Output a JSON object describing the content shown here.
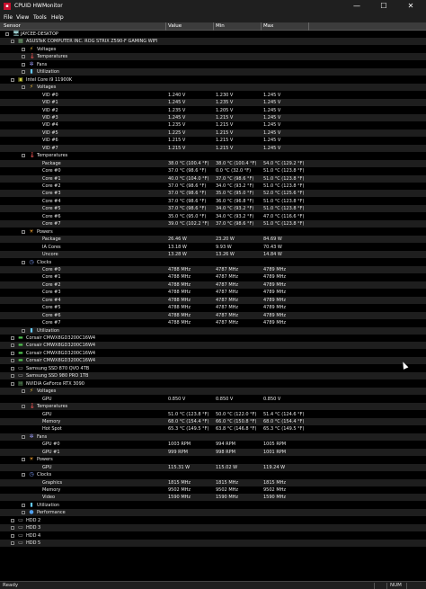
{
  "window": {
    "title": "CPUID HWMonitor",
    "controls": {
      "minimize": "—",
      "maximize": "☐",
      "close": "✕"
    }
  },
  "menu": [
    "File",
    "View",
    "Tools",
    "Help"
  ],
  "columns": {
    "sensor": "Sensor",
    "value": "Value",
    "min": "Min",
    "max": "Max"
  },
  "rows": [
    {
      "level": 0,
      "icon": "computer-icon",
      "label": "JAYCEE-DESKTOP"
    },
    {
      "level": 1,
      "icon": "motherboard-icon",
      "label": "ASUSTeK COMPUTER INC. ROG STRIX Z590-F GAMING WIFI"
    },
    {
      "level": 2,
      "icon": "voltage-icon",
      "label": "Voltages"
    },
    {
      "level": 2,
      "icon": "temperature-icon",
      "label": "Temperatures"
    },
    {
      "level": 2,
      "icon": "fan-icon",
      "label": "Fans"
    },
    {
      "level": 2,
      "icon": "utilization-icon",
      "label": "Utilization"
    },
    {
      "level": 1,
      "icon": "cpu-icon",
      "label": "Intel Core i9 11900K"
    },
    {
      "level": 2,
      "icon": "voltage-icon",
      "label": "Voltages"
    },
    {
      "level": 3,
      "label": "VID #0",
      "value": "1.240 V",
      "min": "1.230 V",
      "max": "1.245 V"
    },
    {
      "level": 3,
      "label": "VID #1",
      "value": "1.245 V",
      "min": "1.235 V",
      "max": "1.245 V"
    },
    {
      "level": 3,
      "label": "VID #2",
      "value": "1.235 V",
      "min": "1.205 V",
      "max": "1.245 V"
    },
    {
      "level": 3,
      "label": "VID #3",
      "value": "1.245 V",
      "min": "1.215 V",
      "max": "1.245 V"
    },
    {
      "level": 3,
      "label": "VID #4",
      "value": "1.235 V",
      "min": "1.215 V",
      "max": "1.245 V"
    },
    {
      "level": 3,
      "label": "VID #5",
      "value": "1.225 V",
      "min": "1.215 V",
      "max": "1.245 V"
    },
    {
      "level": 3,
      "label": "VID #6",
      "value": "1.215 V",
      "min": "1.215 V",
      "max": "1.245 V"
    },
    {
      "level": 3,
      "label": "VID #7",
      "value": "1.215 V",
      "min": "1.215 V",
      "max": "1.245 V"
    },
    {
      "level": 2,
      "icon": "temperature-icon",
      "label": "Temperatures"
    },
    {
      "level": 3,
      "label": "Package",
      "value": "38.0 °C  (100.4 °F)",
      "min": "38.0 °C  (100.4 °F)",
      "max": "54.0 °C  (129.2 °F)"
    },
    {
      "level": 3,
      "label": "Core #0",
      "value": "37.0 °C  (98.6 °F)",
      "min": "0.0 °C  (32.0 °F)",
      "max": "51.0 °C  (123.8 °F)"
    },
    {
      "level": 3,
      "label": "Core #1",
      "value": "40.0 °C  (104.0 °F)",
      "min": "37.0 °C  (98.6 °F)",
      "max": "51.0 °C  (123.8 °F)"
    },
    {
      "level": 3,
      "label": "Core #2",
      "value": "37.0 °C  (98.6 °F)",
      "min": "34.0 °C  (93.2 °F)",
      "max": "51.0 °C  (123.8 °F)"
    },
    {
      "level": 3,
      "label": "Core #3",
      "value": "37.0 °C  (98.6 °F)",
      "min": "35.0 °C  (95.0 °F)",
      "max": "52.0 °C  (125.6 °F)"
    },
    {
      "level": 3,
      "label": "Core #4",
      "value": "37.0 °C  (98.6 °F)",
      "min": "36.0 °C  (96.8 °F)",
      "max": "51.0 °C  (123.8 °F)"
    },
    {
      "level": 3,
      "label": "Core #5",
      "value": "37.0 °C  (98.6 °F)",
      "min": "34.0 °C  (93.2 °F)",
      "max": "51.0 °C  (123.8 °F)"
    },
    {
      "level": 3,
      "label": "Core #6",
      "value": "35.0 °C  (95.0 °F)",
      "min": "34.0 °C  (93.2 °F)",
      "max": "47.0 °C  (116.6 °F)"
    },
    {
      "level": 3,
      "label": "Core #7",
      "value": "39.0 °C  (102.2 °F)",
      "min": "37.0 °C  (98.6 °F)",
      "max": "51.0 °C  (123.8 °F)"
    },
    {
      "level": 2,
      "icon": "power-icon",
      "label": "Powers"
    },
    {
      "level": 3,
      "label": "Package",
      "value": "26.46 W",
      "min": "23.20 W",
      "max": "84.69 W"
    },
    {
      "level": 3,
      "label": "IA Cores",
      "value": "13.18 W",
      "min": "9.93 W",
      "max": "70.43 W"
    },
    {
      "level": 3,
      "label": "Uncore",
      "value": "13.28 W",
      "min": "13.26 W",
      "max": "14.84 W"
    },
    {
      "level": 2,
      "icon": "clock-icon",
      "label": "Clocks"
    },
    {
      "level": 3,
      "label": "Core #0",
      "value": "4788 MHz",
      "min": "4787 MHz",
      "max": "4789 MHz"
    },
    {
      "level": 3,
      "label": "Core #1",
      "value": "4788 MHz",
      "min": "4787 MHz",
      "max": "4789 MHz"
    },
    {
      "level": 3,
      "label": "Core #2",
      "value": "4788 MHz",
      "min": "4787 MHz",
      "max": "4789 MHz"
    },
    {
      "level": 3,
      "label": "Core #3",
      "value": "4788 MHz",
      "min": "4787 MHz",
      "max": "4789 MHz"
    },
    {
      "level": 3,
      "label": "Core #4",
      "value": "4788 MHz",
      "min": "4787 MHz",
      "max": "4789 MHz"
    },
    {
      "level": 3,
      "label": "Core #5",
      "value": "4788 MHz",
      "min": "4787 MHz",
      "max": "4789 MHz"
    },
    {
      "level": 3,
      "label": "Core #6",
      "value": "4788 MHz",
      "min": "4787 MHz",
      "max": "4789 MHz"
    },
    {
      "level": 3,
      "label": "Core #7",
      "value": "4788 MHz",
      "min": "4787 MHz",
      "max": "4789 MHz"
    },
    {
      "level": 2,
      "icon": "utilization-icon",
      "label": "Utilization"
    },
    {
      "level": 1,
      "icon": "memory-icon",
      "label": "Corsair CMWX8GD3200C16W4"
    },
    {
      "level": 1,
      "icon": "memory-icon",
      "label": "Corsair CMWX8GD3200C16W4"
    },
    {
      "level": 1,
      "icon": "memory-icon",
      "label": "Corsair CMWX8GD3200C16W4"
    },
    {
      "level": 1,
      "icon": "memory-icon",
      "label": "Corsair CMWX8GD3200C16W4"
    },
    {
      "level": 1,
      "icon": "drive-icon",
      "label": "Samsung SSD 870 QVO 4TB"
    },
    {
      "level": 1,
      "icon": "drive-icon",
      "label": "Samsung SSD 980 PRO 1TB"
    },
    {
      "level": 1,
      "icon": "gpu-icon",
      "label": "NVIDIA GeForce RTX 3090"
    },
    {
      "level": 2,
      "icon": "voltage-icon",
      "label": "Voltages"
    },
    {
      "level": 3,
      "label": "GPU",
      "value": "0.850 V",
      "min": "0.850 V",
      "max": "0.850 V"
    },
    {
      "level": 2,
      "icon": "temperature-icon",
      "label": "Temperatures"
    },
    {
      "level": 3,
      "label": "GPU",
      "value": "51.0 °C  (123.8 °F)",
      "min": "50.0 °C  (122.0 °F)",
      "max": "51.4 °C  (124.6 °F)"
    },
    {
      "level": 3,
      "label": "Memory",
      "value": "68.0 °C  (154.4 °F)",
      "min": "66.0 °C  (150.8 °F)",
      "max": "68.0 °C  (154.4 °F)"
    },
    {
      "level": 3,
      "label": "Hot Spot",
      "value": "65.3 °C  (149.5 °F)",
      "min": "63.8 °C  (146.8 °F)",
      "max": "65.3 °C  (149.5 °F)"
    },
    {
      "level": 2,
      "icon": "fan-icon",
      "label": "Fans"
    },
    {
      "level": 3,
      "label": "GPU #0",
      "value": "1003 RPM",
      "min": "994 RPM",
      "max": "1005 RPM"
    },
    {
      "level": 3,
      "label": "GPU #1",
      "value": "999 RPM",
      "min": "998 RPM",
      "max": "1001 RPM"
    },
    {
      "level": 2,
      "icon": "power-icon",
      "label": "Powers"
    },
    {
      "level": 3,
      "label": "GPU",
      "value": "115.31 W",
      "min": "115.02 W",
      "max": "119.24 W"
    },
    {
      "level": 2,
      "icon": "clock-icon",
      "label": "Clocks"
    },
    {
      "level": 3,
      "label": "Graphics",
      "value": "1815 MHz",
      "min": "1815 MHz",
      "max": "1815 MHz"
    },
    {
      "level": 3,
      "label": "Memory",
      "value": "9502 MHz",
      "min": "9502 MHz",
      "max": "9502 MHz"
    },
    {
      "level": 3,
      "label": "Video",
      "value": "1590 MHz",
      "min": "1590 MHz",
      "max": "1590 MHz"
    },
    {
      "level": 2,
      "icon": "utilization-icon",
      "label": "Utilization"
    },
    {
      "level": 2,
      "icon": "performance-icon",
      "label": "Performance"
    },
    {
      "level": 1,
      "icon": "drive-icon",
      "label": "HDD 2"
    },
    {
      "level": 1,
      "icon": "drive-icon",
      "label": "HDD 3"
    },
    {
      "level": 1,
      "icon": "drive-icon",
      "label": "HDD 4"
    },
    {
      "level": 1,
      "icon": "drive-icon",
      "label": "HDD 5"
    }
  ],
  "status": {
    "text": "Ready",
    "num": "NUM"
  }
}
